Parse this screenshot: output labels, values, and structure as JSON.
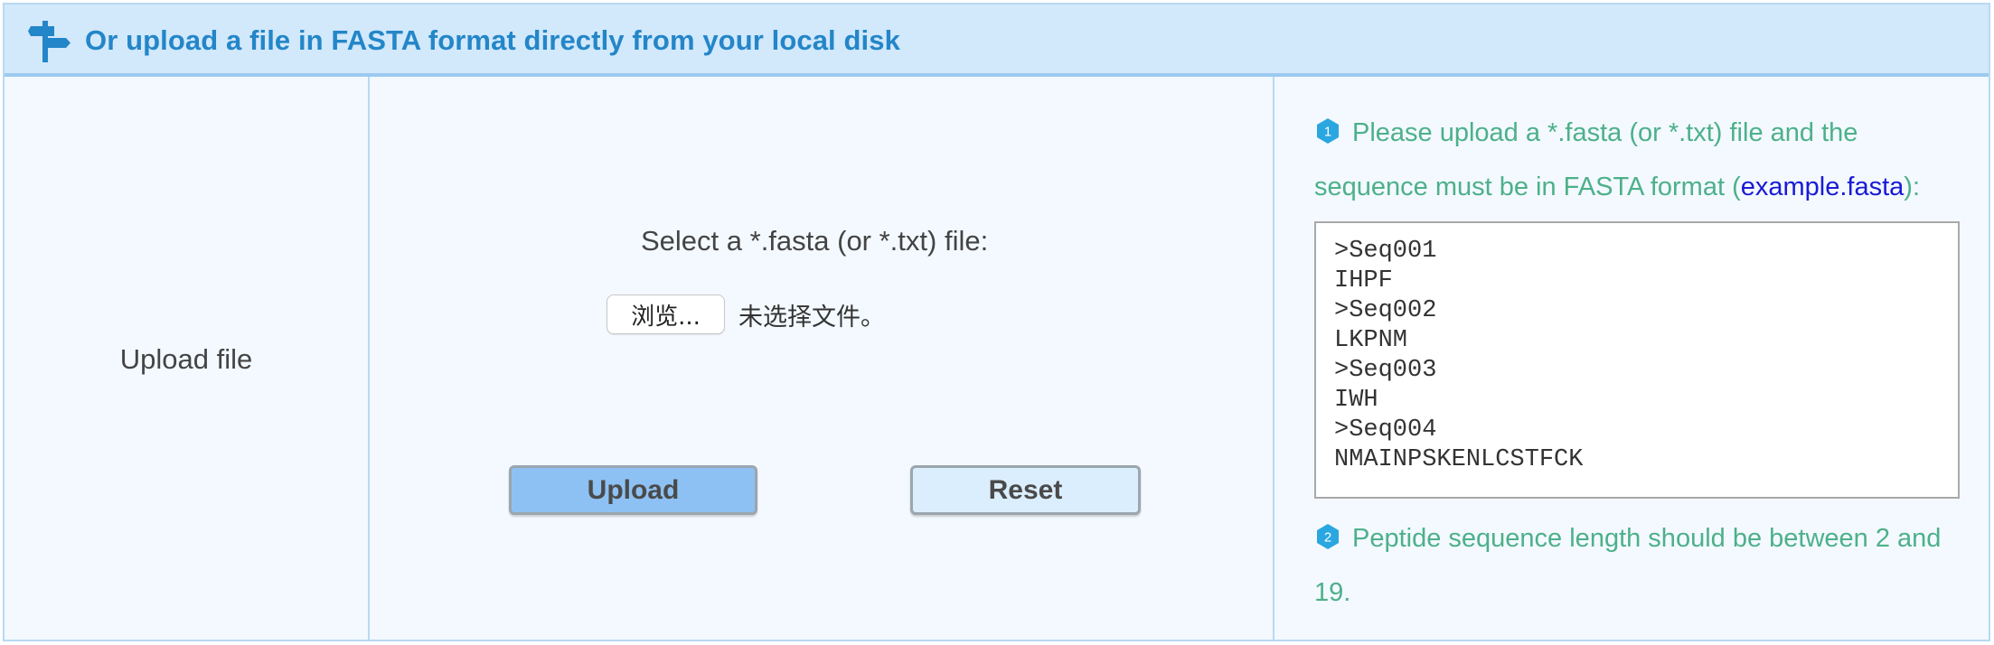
{
  "header": {
    "title": "Or upload a file in FASTA format directly from your local disk",
    "icon": "signpost-icon",
    "accent_color": "#2386c8"
  },
  "row": {
    "label": "Upload file"
  },
  "upload_form": {
    "select_label": "Select a *.fasta (or *.txt) file:",
    "browse_label": "浏览...",
    "no_file_text": "未选择文件。",
    "upload_label": "Upload",
    "reset_label": "Reset"
  },
  "notes": {
    "note1_number": "1",
    "note1_text": "Please upload a *.fasta (or *.txt) file and the sequence must be in FASTA format (",
    "note1_link": "example.fasta",
    "note1_tail": "):",
    "example_lines": [
      ">Seq001",
      "IHPF",
      ">Seq002",
      "LKPNM",
      ">Seq003",
      "IWH",
      ">Seq004",
      "NMAINPSKENLCSTFCK"
    ],
    "note2_number": "2",
    "note2_text": "Peptide sequence length should be between 2 and 19."
  },
  "colors": {
    "header_bg": "#d2e8fb",
    "body_bg": "#f3f9fe",
    "note_text": "#4db08a",
    "badge": "#2aa7e0",
    "upload_button": "#8dc1f3",
    "reset_button": "#dbeefd"
  }
}
